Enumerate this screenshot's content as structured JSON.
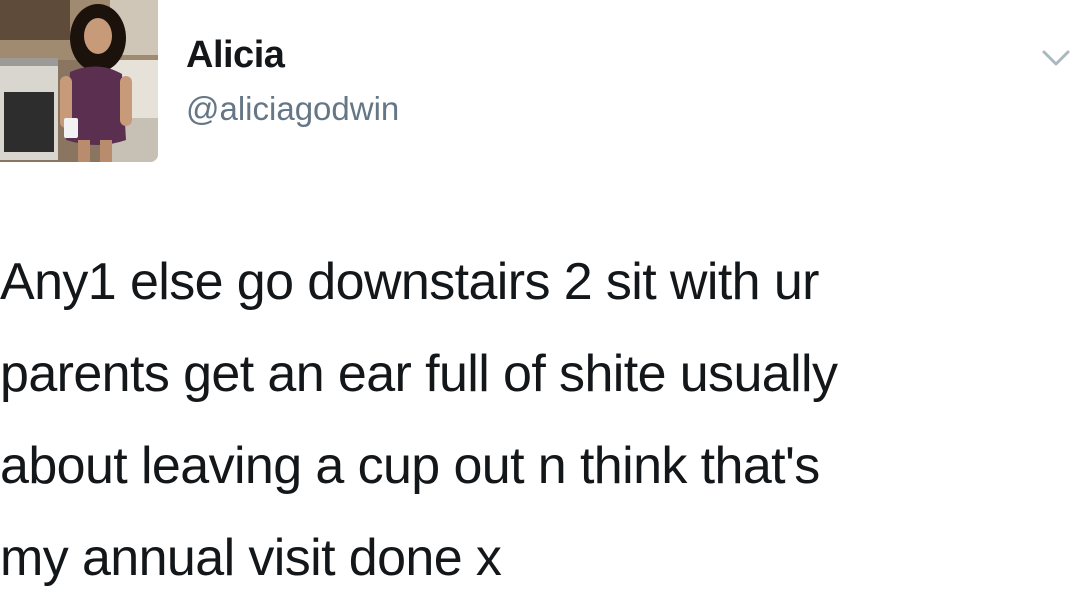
{
  "tweet": {
    "author": {
      "name": "Alicia",
      "handle": "@aliciagodwin",
      "avatar_icon": "profile-photo"
    },
    "menu_icon": "chevron-down-icon",
    "text_lines": [
      "Any1 else go downstairs 2 sit with ur",
      "parents get an ear full of shite usually",
      "about leaving a cup out n think that's",
      "my annual visit done x"
    ]
  },
  "colors": {
    "text": "#14171a",
    "handle": "#657786",
    "caret": "#aab8c2"
  }
}
